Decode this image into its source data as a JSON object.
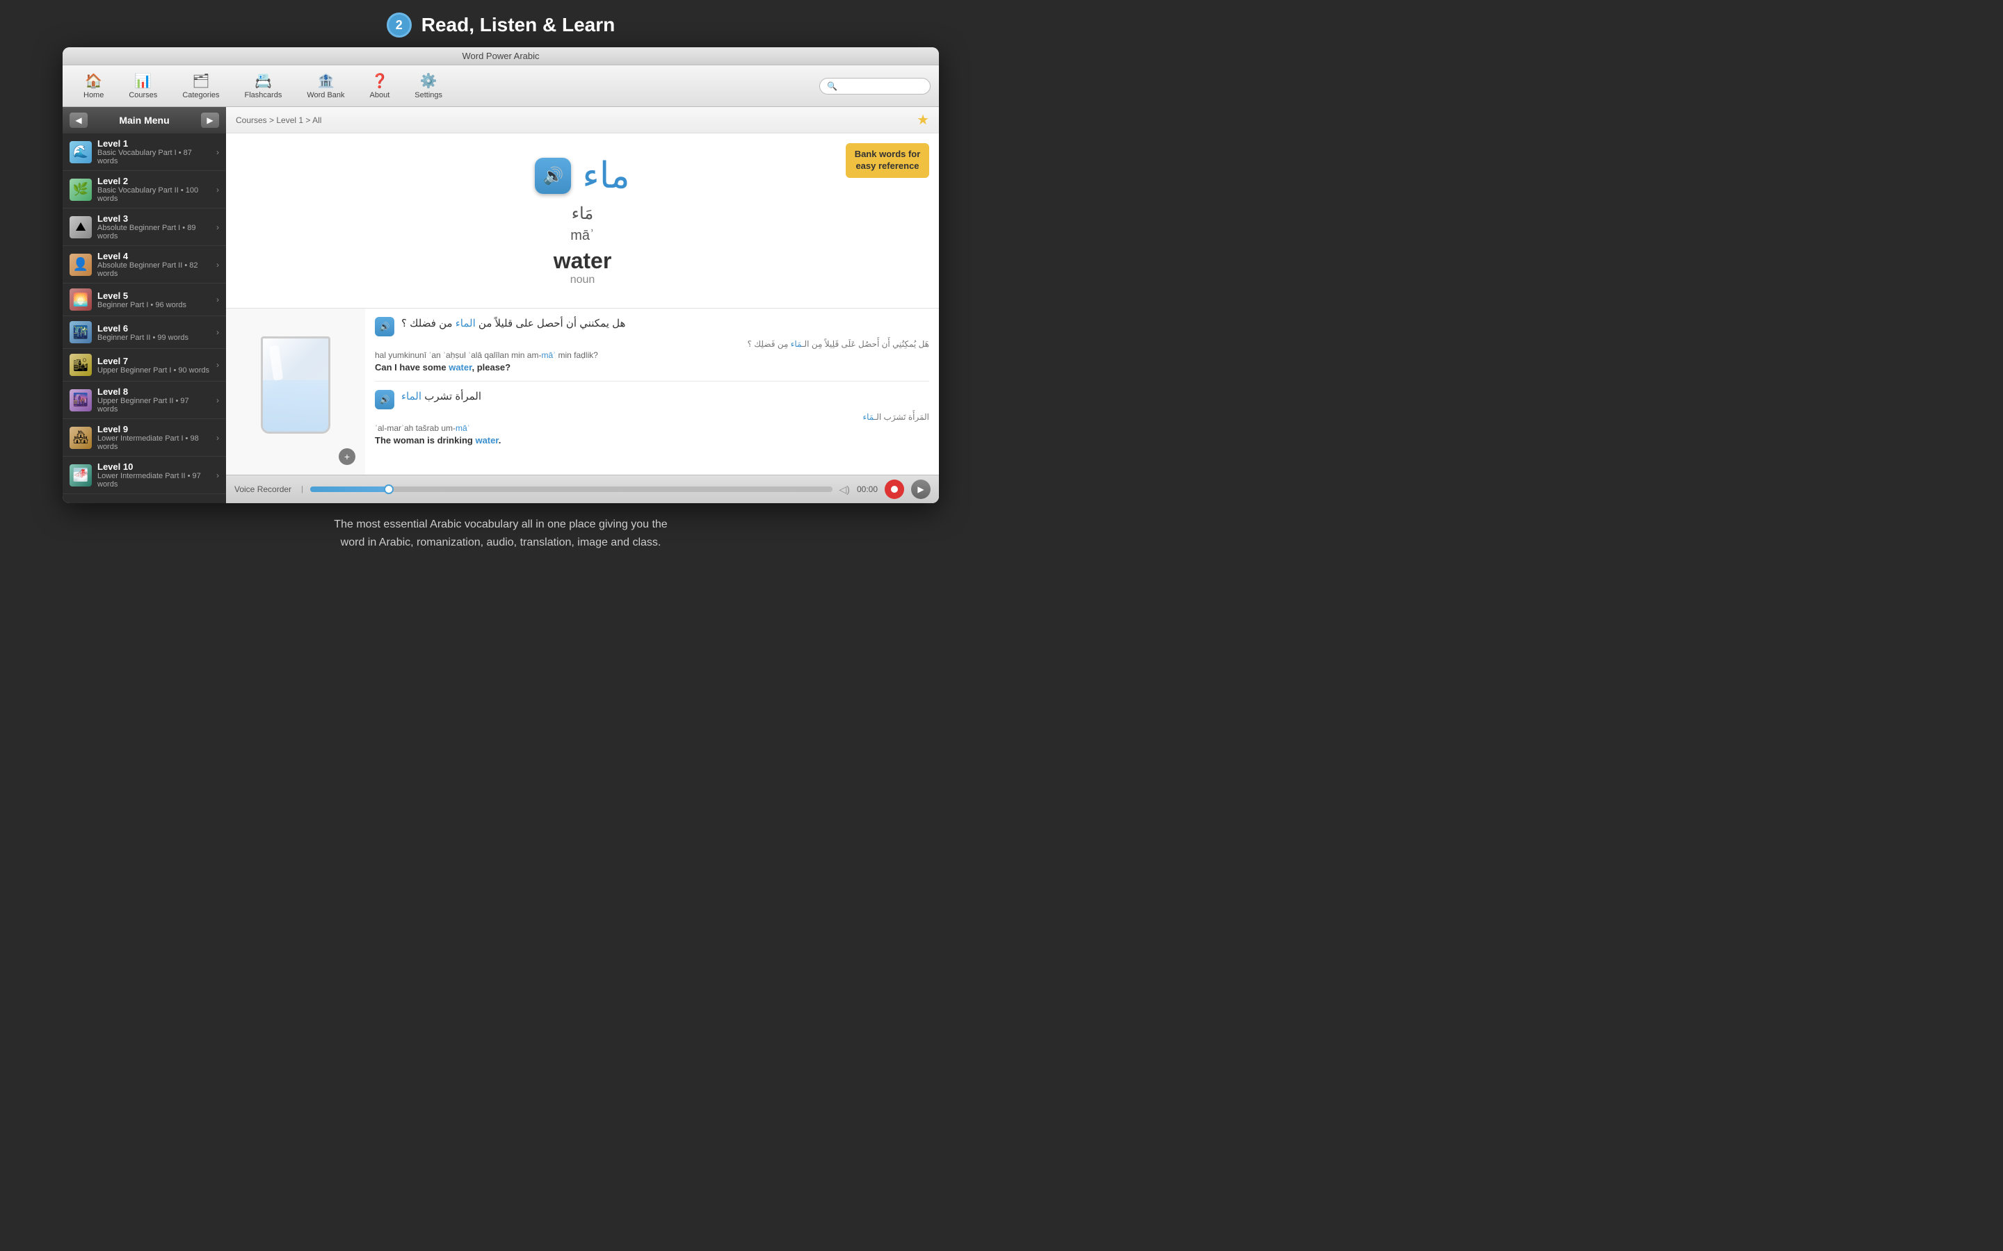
{
  "topBar": {
    "stepNumber": "2",
    "title": "Read, Listen & Learn"
  },
  "appTitle": "Word Power Arabic",
  "toolbar": {
    "items": [
      {
        "id": "home",
        "icon": "🏠",
        "label": "Home"
      },
      {
        "id": "courses",
        "icon": "📊",
        "label": "Courses"
      },
      {
        "id": "categories",
        "icon": "🗂",
        "label": "Categories"
      },
      {
        "id": "flashcards",
        "icon": "📇",
        "label": "Flashcards"
      },
      {
        "id": "wordbank",
        "icon": "🏦",
        "label": "Word Bank"
      },
      {
        "id": "about",
        "icon": "❓",
        "label": "About"
      },
      {
        "id": "settings",
        "icon": "⚙️",
        "label": "Settings"
      }
    ],
    "searchPlaceholder": ""
  },
  "sidebar": {
    "title": "Main Menu",
    "items": [
      {
        "level": "Level 1",
        "subtitle": "Basic Vocabulary Part I • 87 words",
        "thumbClass": "thumb-1",
        "emoji": "🌊"
      },
      {
        "level": "Level 2",
        "subtitle": "Basic Vocabulary Part II • 100 words",
        "thumbClass": "thumb-2",
        "emoji": "🌿"
      },
      {
        "level": "Level 3",
        "subtitle": "Absolute Beginner Part I • 89 words",
        "thumbClass": "thumb-3",
        "emoji": "⛰"
      },
      {
        "level": "Level 4",
        "subtitle": "Absolute Beginner Part II • 82 words",
        "thumbClass": "thumb-4",
        "emoji": "👤"
      },
      {
        "level": "Level 5",
        "subtitle": "Beginner Part I • 96 words",
        "thumbClass": "thumb-5",
        "emoji": "🌅"
      },
      {
        "level": "Level 6",
        "subtitle": "Beginner Part II • 99 words",
        "thumbClass": "thumb-6",
        "emoji": "🌃"
      },
      {
        "level": "Level 7",
        "subtitle": "Upper Beginner Part I • 90 words",
        "thumbClass": "thumb-7",
        "emoji": "🏙"
      },
      {
        "level": "Level 8",
        "subtitle": "Upper Beginner Part II • 97 words",
        "thumbClass": "thumb-8",
        "emoji": "🌆"
      },
      {
        "level": "Level 9",
        "subtitle": "Lower Intermediate Part I • 98 words",
        "thumbClass": "thumb-9",
        "emoji": "🏘"
      },
      {
        "level": "Level 10",
        "subtitle": "Lower Intermediate Part II • 97 words",
        "thumbClass": "thumb-10",
        "emoji": "🌁"
      }
    ]
  },
  "content": {
    "breadcrumb": "Courses > Level 1 > All",
    "wordArabic": "ماء",
    "wordTranslitArabic": "مَاء",
    "wordTranslit": "māʾ",
    "wordEnglish": "water",
    "wordClass": "noun",
    "bankTooltip": "Bank words for easy reference",
    "sentences": [
      {
        "arabicMain": "هل يمكنني أن أحصل على قليلاً من الماء من فضلك ؟",
        "arabicTranslit1": "هَل يُمكِنُنِي أَن أَحصُل عَلَى قَلِيلاً مِن الـ",
        "arabicHighlight1": "مَاء",
        "arabicTranslit1b": " مِن فَضلِك ؟",
        "translit": "hal yumkinunī ʾan ʾaḥṣul ʿalā qalīlan min am-",
        "translitHighlight": "māʾ",
        "translitEnd": " min faḍlik?",
        "english": "Can I have some ",
        "englishHighlight": "water",
        "englishEnd": ", please?"
      },
      {
        "arabicMain": "المرأة تشرب الماء",
        "arabicTranslit1": "المَرأَة تَشرَب الـ",
        "arabicHighlight1": "مَاء",
        "arabicTranslit1b": "",
        "translit": "ʾal-marʾah tašrab um-",
        "translitHighlight": "māʾ",
        "translitEnd": "",
        "english": "The woman is drinking ",
        "englishHighlight": "water",
        "englishEnd": "."
      }
    ],
    "recorder": {
      "label": "Voice Recorder",
      "progressPercent": 15,
      "timeDisplay": "00:00"
    }
  },
  "bottomText": {
    "line1": "The most essential Arabic vocabulary all in one place giving you the",
    "line2": "word in Arabic, romanization, audio, translation, image and class."
  }
}
